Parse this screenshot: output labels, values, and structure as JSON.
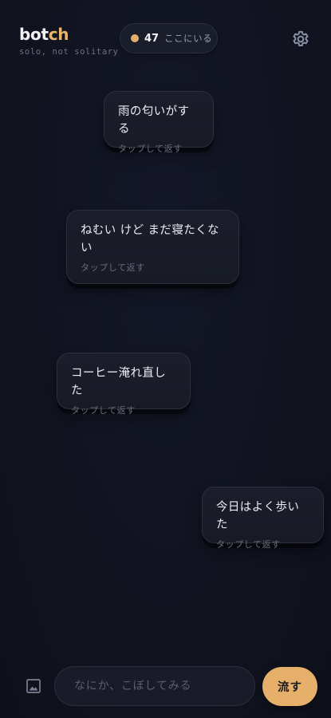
{
  "brand": {
    "logo_main": "bot",
    "logo_accent": "ch",
    "tagline": "solo, not solitary"
  },
  "presence": {
    "count": "47",
    "label": "ここにいる"
  },
  "settings": {
    "icon": "gear-icon"
  },
  "bubbles": [
    {
      "text": "雨の匂いがする",
      "hint": "タップして返す"
    },
    {
      "text": "ねむい けど まだ寝たくない",
      "hint": "タップして返す"
    },
    {
      "text": "コーヒー淹れ直した",
      "hint": "タップして返す"
    },
    {
      "text": "今日はよく歩いた",
      "hint": "タップして返す"
    }
  ],
  "composer": {
    "image_icon": "image-icon",
    "placeholder": "なにか、こぼしてみる",
    "value": "",
    "send_label": "流す"
  },
  "colors": {
    "background": "#11131f",
    "accent": "#e6b06a",
    "bubble": "#1a1d29",
    "muted_text": "#686c7b"
  }
}
